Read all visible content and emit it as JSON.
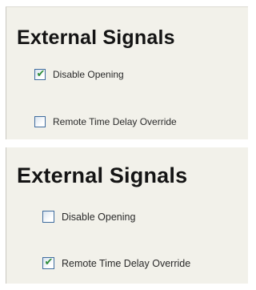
{
  "panels": [
    {
      "title": "External Signals",
      "options": [
        {
          "label": "Disable Opening",
          "checked": true
        },
        {
          "label": "Remote Time Delay Override",
          "checked": false
        }
      ]
    },
    {
      "title": "External Signals",
      "options": [
        {
          "label": "Disable Opening",
          "checked": false
        },
        {
          "label": "Remote Time Delay Override",
          "checked": true
        }
      ]
    }
  ],
  "colors": {
    "panel_background": "#f2f1ea",
    "checkbox_border": "#3f6c9e",
    "checkmark": "#2f8d3a"
  },
  "icons": {
    "checked": "checkmark-icon"
  }
}
